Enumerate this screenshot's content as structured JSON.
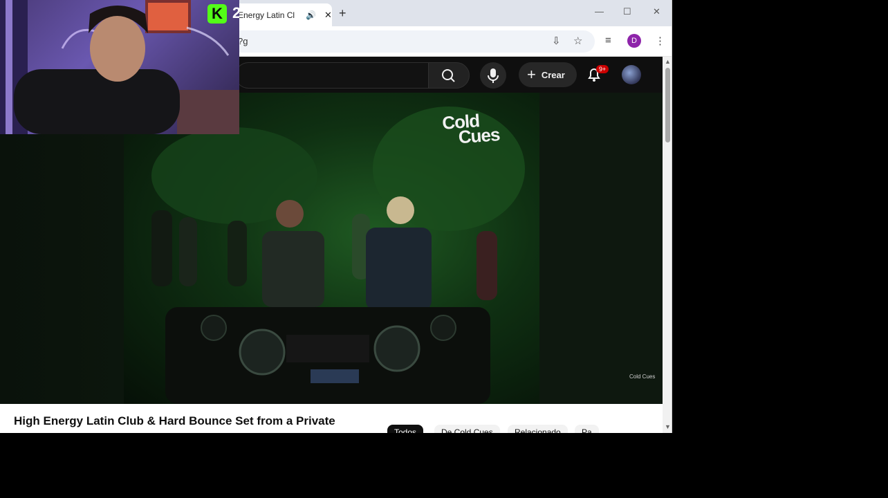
{
  "browser": {
    "tab_title": "Energy Latin Cl",
    "tab_audio_icon": "speaker-icon",
    "address_fragment": "?g",
    "profile_initial": "D"
  },
  "youtube": {
    "create_label": "Crear",
    "notifications_badge": "9+",
    "video_title": "High Energy Latin Club & Hard Bounce Set from a Private",
    "video_overlay_logo_line1": "Cold",
    "video_overlay_logo_line2": "Cues",
    "video_watermark": "Cold Cues",
    "chips": [
      "Todos",
      "De Cold Cues",
      "Relacionado",
      "Pa"
    ]
  },
  "overlay": {
    "kick_logo": "K",
    "viewer_count": "2"
  },
  "colors": {
    "youtube_bg": "#0f0f0f",
    "kick_green": "#53fc18",
    "notification_red": "#cc0000",
    "profile_purple": "#8e24aa"
  }
}
